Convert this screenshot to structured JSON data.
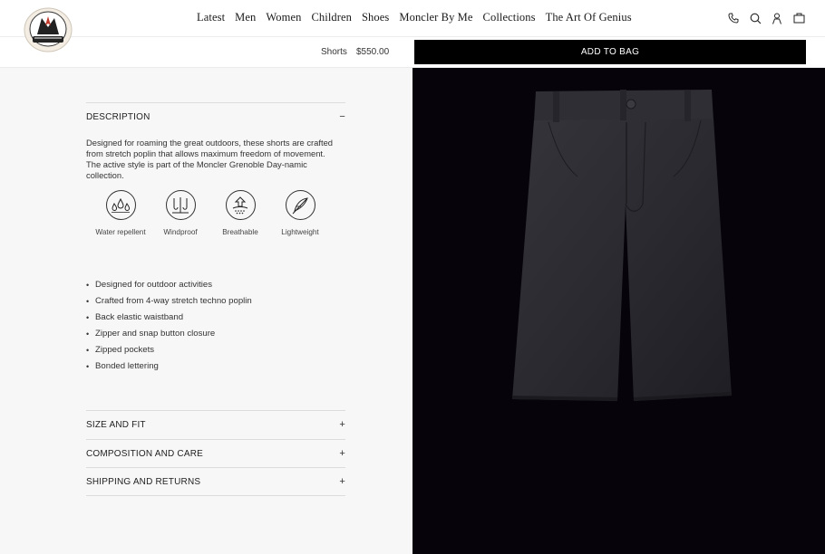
{
  "header": {
    "nav": [
      "Latest",
      "Men",
      "Women",
      "Children",
      "Shoes",
      "Moncler By Me",
      "Collections",
      "The Art Of Genius"
    ],
    "icons": [
      "phone-icon",
      "search-icon",
      "account-icon",
      "bag-icon"
    ]
  },
  "sticky": {
    "product_name": "Shorts",
    "price": "$550.00",
    "add_to_bag": "ADD TO BAG"
  },
  "description": {
    "heading": "DESCRIPTION",
    "toggle": "−",
    "text": "Designed for roaming the great outdoors, these shorts are crafted from stretch poplin that allows maximum freedom of movement. The active style is part of the Moncler Grenoble Day-namic collection.",
    "features": [
      {
        "label": "Water repellent",
        "icon": "water-repellent-icon"
      },
      {
        "label": "Windproof",
        "icon": "windproof-icon"
      },
      {
        "label": "Breathable",
        "icon": "breathable-icon"
      },
      {
        "label": "Lightweight",
        "icon": "lightweight-icon"
      }
    ],
    "bullets": [
      "Designed for outdoor activities",
      "Crafted from 4-way stretch techno poplin",
      "Back elastic waistband",
      "Zipper and snap button closure",
      "Zipped pockets",
      "Bonded lettering"
    ]
  },
  "accordions": [
    {
      "label": "SIZE AND FIT",
      "toggle": "+"
    },
    {
      "label": "COMPOSITION AND CARE",
      "toggle": "+"
    },
    {
      "label": "SHIPPING AND RETURNS",
      "toggle": "+"
    }
  ],
  "colors": {
    "accent": "#000000",
    "panel": "#f7f7f7",
    "image_bg": "#06040a",
    "product": "#2a2a2e"
  }
}
